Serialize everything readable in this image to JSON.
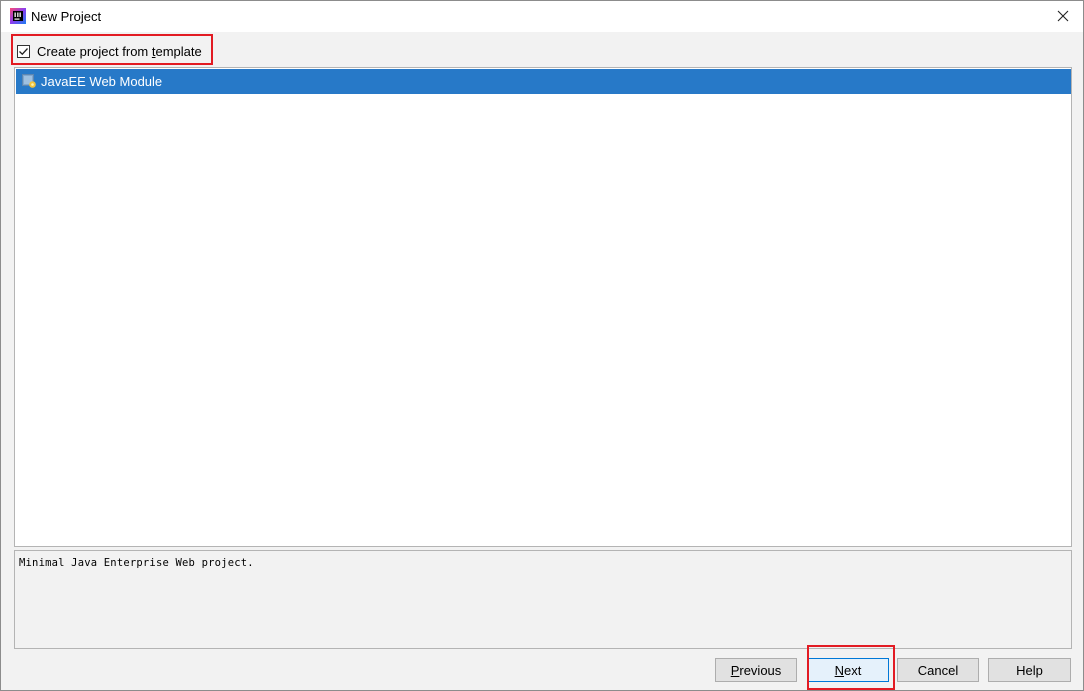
{
  "window": {
    "title": "New Project",
    "app_icon": "intellij-idea-icon",
    "close_icon": "close-icon"
  },
  "template_option": {
    "checked": true,
    "label_before": "Create project from ",
    "label_mnemonic": "t",
    "label_after": "emplate"
  },
  "templates": [
    {
      "label": "JavaEE Web Module",
      "icon": "web-module-icon",
      "selected": true
    }
  ],
  "description": "Minimal Java Enterprise Web project.",
  "buttons": {
    "previous": {
      "mnemonic": "P",
      "rest": "revious"
    },
    "next": {
      "mnemonic": "N",
      "rest": "ext"
    },
    "cancel": "Cancel",
    "help": "Help"
  },
  "colors": {
    "selection": "#2779c8",
    "highlight": "#e21b23",
    "default_button_border": "#0078d7"
  }
}
